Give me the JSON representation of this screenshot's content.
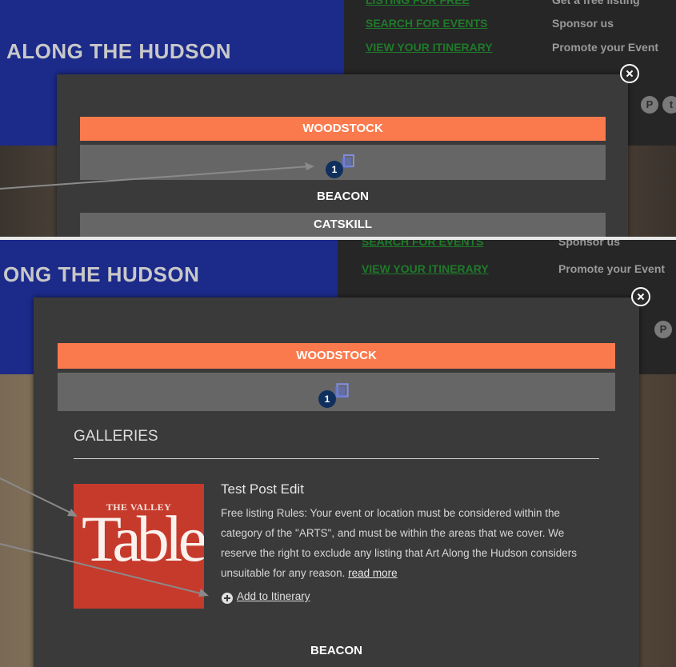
{
  "site": {
    "title_top": "ALONG THE HUDSON",
    "title_bottom": "ONG THE HUDSON"
  },
  "nav": {
    "top_green_partial": "LISTING FOR FREE",
    "search_events": "SEARCH FOR EVENTS",
    "view_itinerary": "VIEW YOUR ITINERARY",
    "get_free_listing": "Get a free listing",
    "sponsor_us": "Sponsor us",
    "promote_event": "Promote your Event"
  },
  "social": {
    "pinterest_label": "P",
    "twitter_label": "t"
  },
  "top_modal": {
    "bar_woodstock": "WOODSTOCK",
    "badge_count": "1",
    "bar_beacon": "BEACON",
    "bar_catskill": "CATSKILL"
  },
  "bottom_modal": {
    "bar_woodstock": "WOODSTOCK",
    "badge_count": "1",
    "section_heading": "GALLERIES",
    "post": {
      "thumb_line1": "THE VALLEY",
      "thumb_line2": "Table",
      "title": "Test Post Edit",
      "description": "Free listing Rules: Your event or location must be considered within the category of the \"ARTS\", and must be within the areas that we cover. We reserve the right to exclude any listing that Art Along the Hudson considers unsuitable for any reason.",
      "read_more": "read more",
      "add_to_itinerary": "Add to Itinerary"
    },
    "bar_beacon": "BEACON"
  },
  "colors": {
    "accent_orange": "#fb7a4d",
    "nav_green": "#1f7a2a",
    "header_blue": "#1c2a8a",
    "modal_bg": "#3a3a3a",
    "bar_gray": "#666666",
    "badge_navy": "#0f2f5e"
  },
  "icons": [
    "close-icon",
    "pinterest-icon",
    "twitter-icon",
    "itinerary-folder-icon",
    "plus-circle-icon"
  ]
}
